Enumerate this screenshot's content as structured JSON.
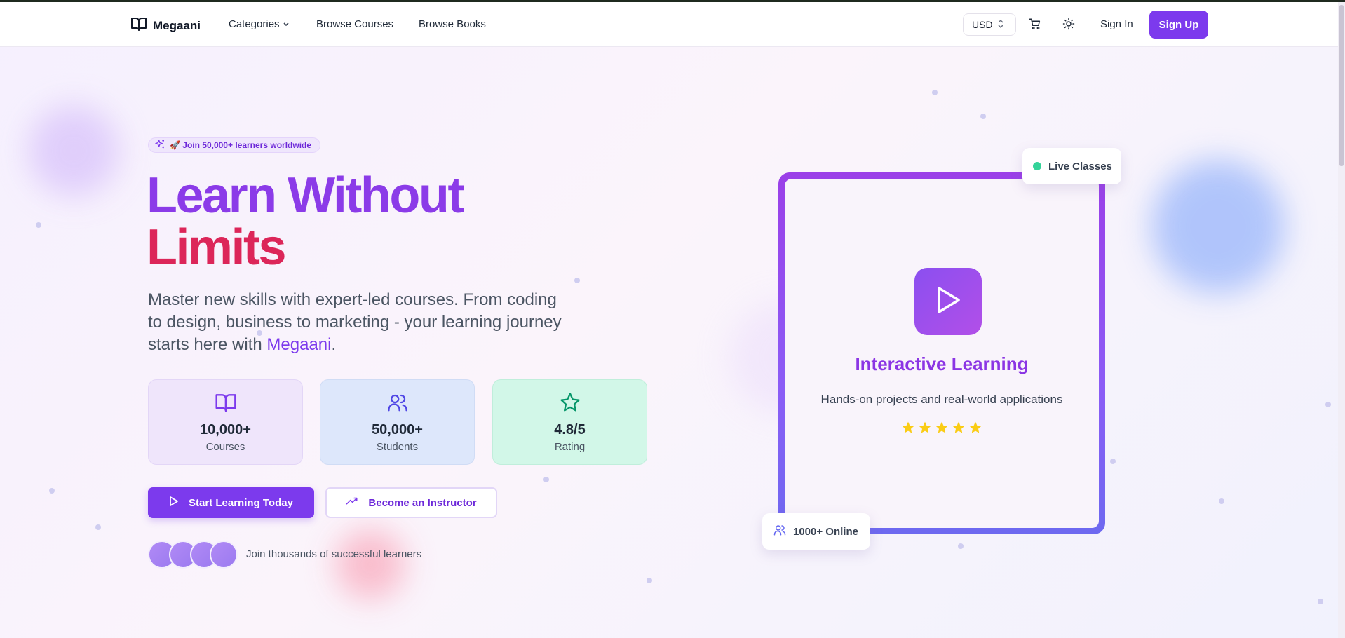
{
  "brand": {
    "name": "Megaani"
  },
  "nav": {
    "categories": "Categories",
    "browse_courses": "Browse Courses",
    "browse_books": "Browse Books"
  },
  "header": {
    "currency": "USD",
    "sign_in": "Sign In",
    "sign_up": "Sign Up"
  },
  "hero": {
    "badge": "🚀 Join 50,000+ learners worldwide",
    "title_line1": "Learn Without",
    "title_line2": "Limits",
    "description_main": "Master new skills with expert-led courses. From coding to design, business to marketing - your learning journey starts here with ",
    "description_brand": "Megaani",
    "description_end": "."
  },
  "stats": [
    {
      "value": "10,000+",
      "label": "Courses",
      "icon": "book-icon"
    },
    {
      "value": "50,000+",
      "label": "Students",
      "icon": "users-icon"
    },
    {
      "value": "4.8/5",
      "label": "Rating",
      "icon": "star-icon"
    }
  ],
  "actions": {
    "primary": "Start Learning Today",
    "secondary": "Become an Instructor"
  },
  "social_proof": "Join thousands of successful learners",
  "feature_card": {
    "title": "Interactive Learning",
    "description": "Hands-on projects and real-world applications",
    "rating_stars": 5
  },
  "floating": {
    "live": "Live Classes",
    "online": "1000+ Online"
  },
  "colors": {
    "accent": "#7c3aed",
    "title_purple": "#8b3be8",
    "title_pink": "#dc2659",
    "live_green": "#34d399",
    "star_yellow": "#facc15"
  }
}
